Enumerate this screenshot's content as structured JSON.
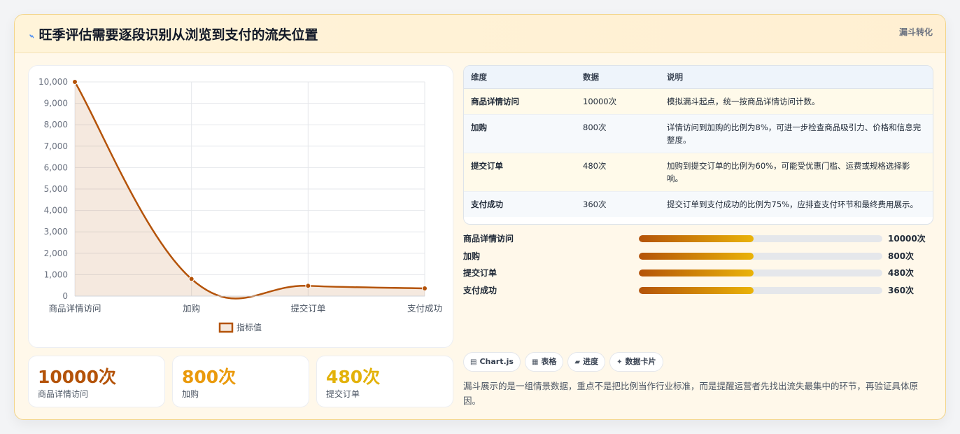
{
  "header": {
    "title": "旺季评估需要逐段识别从浏览到支付的流失位置",
    "tag": "漏斗转化"
  },
  "chart_data": {
    "type": "line",
    "categories": [
      "商品详情访问",
      "加购",
      "提交订单",
      "支付成功"
    ],
    "series": [
      {
        "name": "指标值",
        "values": [
          10000,
          800,
          480,
          360
        ]
      }
    ],
    "ylim": [
      0,
      10000
    ],
    "yticks": [
      "0",
      "1,000",
      "2,000",
      "3,000",
      "4,000",
      "5,000",
      "6,000",
      "7,000",
      "8,000",
      "9,000",
      "10,000"
    ],
    "grid": true,
    "legend": "bottom",
    "fill": true,
    "color": "#b45309"
  },
  "kpis": [
    {
      "value": "10000次",
      "label": "商品详情访问",
      "color": "#b45309"
    },
    {
      "value": "800次",
      "label": "加购",
      "color": "#ea9a0c"
    },
    {
      "value": "480次",
      "label": "提交订单",
      "color": "#e3b20a"
    }
  ],
  "table": {
    "headers": [
      "维度",
      "数据",
      "说明"
    ],
    "rows": [
      {
        "dim": "商品详情访问",
        "val": "10000次",
        "desc": "模拟漏斗起点，统一按商品详情访问计数。"
      },
      {
        "dim": "加购",
        "val": "800次",
        "desc": "详情访问到加购的比例为8%，可进一步检查商品吸引力、价格和信息完整度。"
      },
      {
        "dim": "提交订单",
        "val": "480次",
        "desc": "加购到提交订单的比例为60%，可能受优惠门槛、运费或规格选择影响。"
      },
      {
        "dim": "支付成功",
        "val": "360次",
        "desc": "提交订单到支付成功的比例为75%，应排查支付环节和最终费用展示。"
      }
    ]
  },
  "progress": [
    {
      "label": "商品详情访问",
      "value": "10000次",
      "fill": 0.47
    },
    {
      "label": "加购",
      "value": "800次",
      "fill": 0.47
    },
    {
      "label": "提交订单",
      "value": "480次",
      "fill": 0.47
    },
    {
      "label": "支付成功",
      "value": "360次",
      "fill": 0.47
    }
  ],
  "chips": [
    {
      "icon": "▤",
      "label": "Chart.js",
      "icon_name": "chart-icon"
    },
    {
      "icon": "▦",
      "label": "表格",
      "icon_name": "table-icon"
    },
    {
      "icon": "▰",
      "label": "进度",
      "icon_name": "progress-icon"
    },
    {
      "icon": "✦",
      "label": "数据卡片",
      "icon_name": "sparkle-icon"
    }
  ],
  "note": "漏斗展示的是一组情景数据，重点不是把比例当作行业标准，而是提醒运营者先找出流失最集中的环节，再验证具体原因。"
}
